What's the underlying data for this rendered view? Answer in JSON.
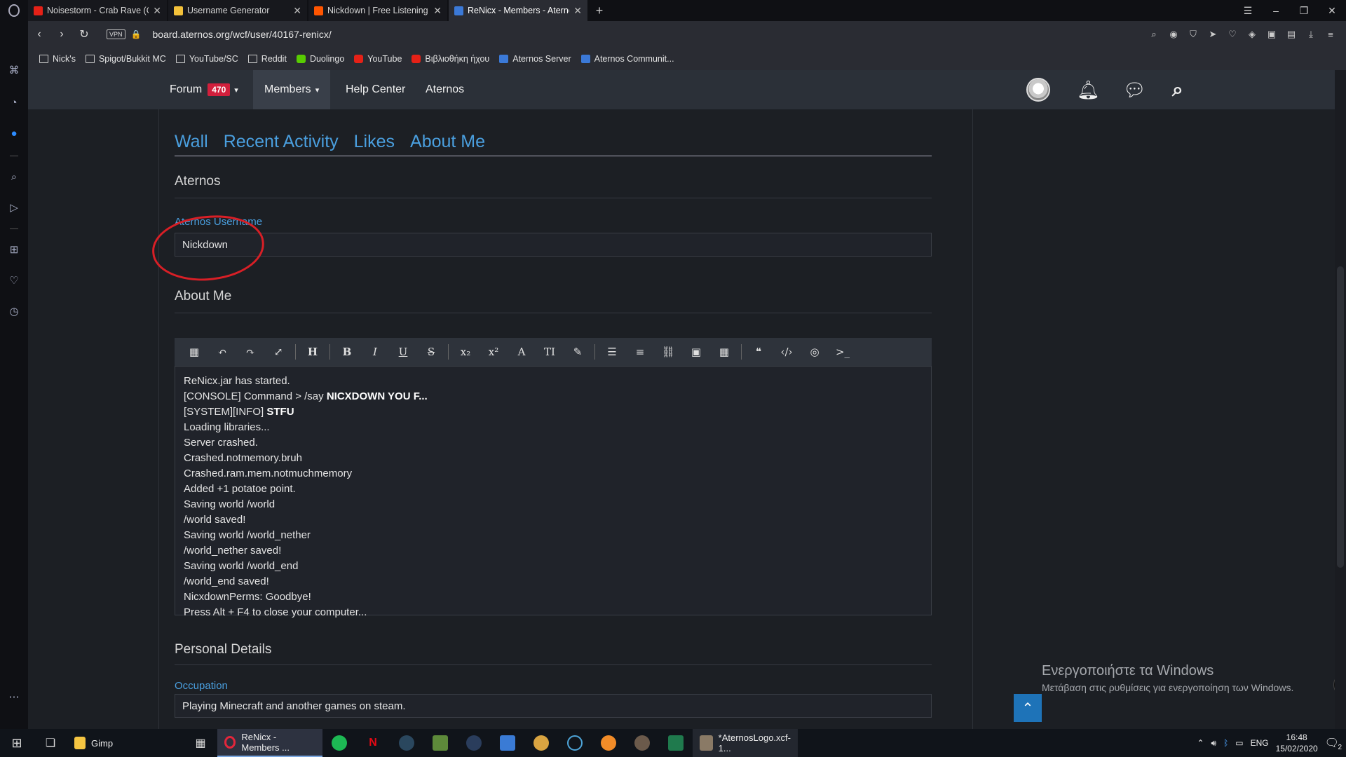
{
  "browser": {
    "tabs": [
      {
        "title": "Noisestorm - Crab Rave (O",
        "color": "#e62117"
      },
      {
        "title": "Username Generator",
        "color": "#f3c13a"
      },
      {
        "title": "Nickdown | Free Listening o",
        "color": "#ff5500"
      },
      {
        "title": "ReNicx - Members - Aterno",
        "color": "#3b79d7",
        "active": true
      }
    ],
    "new_tab": "+",
    "url": "board.aternos.org/wcf/user/40167-renicx/",
    "vpn_label": "VPN",
    "bookmarks": [
      {
        "label": "Nick's",
        "icon": "folder-icon"
      },
      {
        "label": "Spigot/Bukkit MC",
        "icon": "folder-icon"
      },
      {
        "label": "YouTube/SC",
        "icon": "folder-icon"
      },
      {
        "label": "Reddit",
        "icon": "folder-icon"
      },
      {
        "label": "Duolingo",
        "icon": "duolingo-icon"
      },
      {
        "label": "YouTube",
        "icon": "youtube-icon"
      },
      {
        "label": "Βιβλιοθήκη ήχου",
        "icon": "youtube-icon"
      },
      {
        "label": "Aternos Server",
        "icon": "aternos-icon"
      },
      {
        "label": "Aternos Communit...",
        "icon": "aternos-icon"
      }
    ]
  },
  "site_nav": {
    "forum_label": "Forum",
    "forum_badge": "470",
    "members_label": "Members",
    "help_label": "Help Center",
    "aternos_label": "Aternos"
  },
  "profile_tabs": [
    "Wall",
    "Recent Activity",
    "Likes",
    "About Me"
  ],
  "sections": {
    "aternos_title": "Aternos",
    "username_label": "Aternos Username",
    "username_value": "Nickdown",
    "about_title": "About Me",
    "personal_title": "Personal Details",
    "occupation_label": "Occupation",
    "occupation_value": "Playing Minecraft and another games on steam."
  },
  "editor_lines": [
    {
      "text": "ReNicx.jar has started."
    },
    {
      "text": "[CONSOLE] Command > /say ",
      "bold": "NICXDOWN YOU F..."
    },
    {
      "text": "[SYSTEM][INFO] ",
      "bold": "STFU"
    },
    {
      "text": "Loading libraries..."
    },
    {
      "text": "Server crashed."
    },
    {
      "text": "Crashed.notmemory.bruh"
    },
    {
      "text": "Crashed.ram.mem.notmuchmemory"
    },
    {
      "text": "Added +1 potatoe point."
    },
    {
      "text": "Saving world /world"
    },
    {
      "text": "/world saved!"
    },
    {
      "text": "Saving world /world_nether"
    },
    {
      "text": "/world_nether saved!"
    },
    {
      "text": "Saving world /world_end"
    },
    {
      "text": "/world_end saved!"
    },
    {
      "text": "NicxdownPerms: Goodbye!"
    },
    {
      "text": "Press Alt + F4 to close your computer..."
    }
  ],
  "windows_activation": {
    "line1": "Ενεργοποιήστε τα Windows",
    "line2": "Μετάβαση στις ρυθμίσεις για ενεργοποίηση των Windows."
  },
  "taskbar": {
    "gimp_label": "Gimp",
    "browser_label": "ReNicx - Members ...",
    "gimp_file_label": "*AternosLogo.xcf-1...",
    "lang": "ENG",
    "time": "16:48",
    "date": "15/02/2020",
    "notif_count": "2"
  },
  "colors": {
    "accent": "#4a9fdf",
    "badge": "#d21f3c",
    "annotation": "#d81f26"
  }
}
